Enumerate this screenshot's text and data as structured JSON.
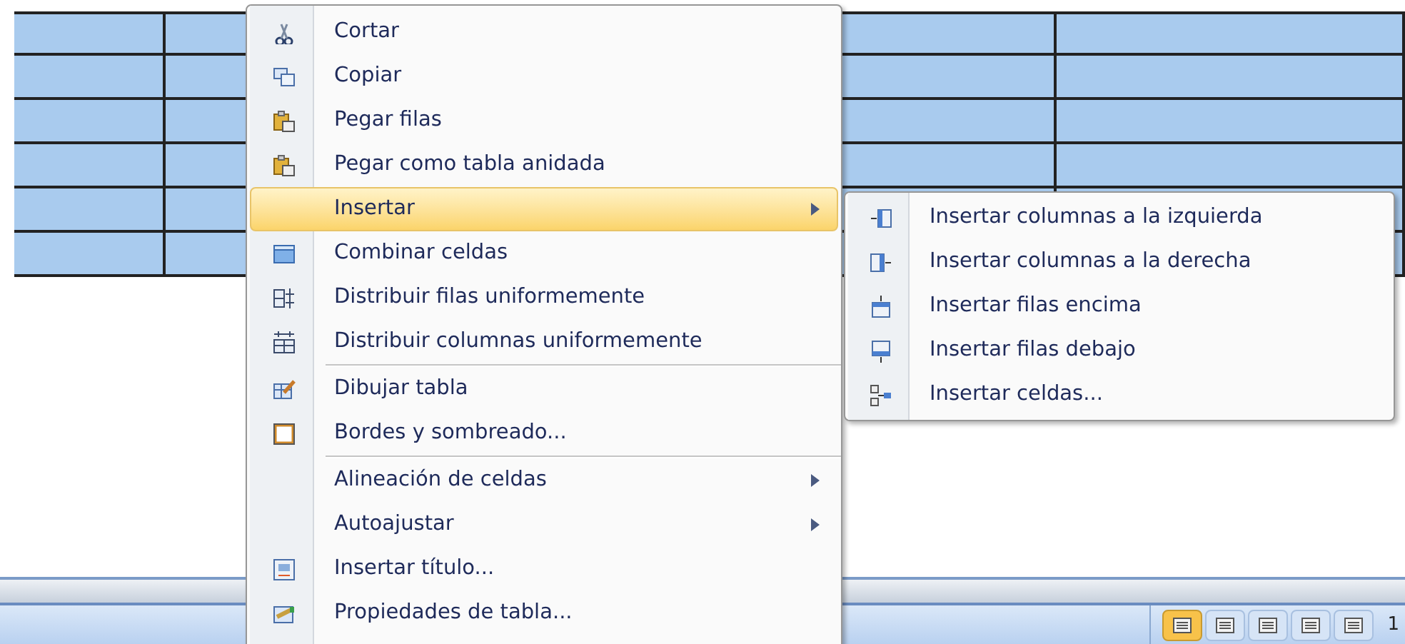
{
  "table": {
    "rows": [
      {
        "selected": true
      },
      {
        "selected": true
      },
      {
        "selected": true
      },
      {
        "selected": true
      },
      {
        "selected": true
      },
      {
        "selected": true
      }
    ]
  },
  "context_menu": {
    "items": [
      {
        "kind": "command",
        "label": "Cortar",
        "selected": false
      },
      {
        "kind": "command",
        "label": "Copiar",
        "selected": false
      },
      {
        "kind": "command",
        "label": "Pegar filas",
        "selected": false
      },
      {
        "kind": "command",
        "label": "Pegar como tabla anidada",
        "selected": false
      },
      {
        "kind": "submenu",
        "label": "Insertar",
        "selected": true
      },
      {
        "kind": "command",
        "label": "Combinar celdas",
        "selected": false
      },
      {
        "kind": "command",
        "label": "Distribuir filas uniformemente",
        "selected": false
      },
      {
        "kind": "command",
        "label": "Distribuir columnas uniformemente",
        "selected": false
      },
      {
        "kind": "separator"
      },
      {
        "kind": "command",
        "label": "Dibujar tabla",
        "selected": false
      },
      {
        "kind": "command",
        "label": "Bordes y sombreado...",
        "selected": false
      },
      {
        "kind": "separator"
      },
      {
        "kind": "submenu",
        "label": "Alineación de celdas",
        "selected": false
      },
      {
        "kind": "submenu",
        "label": "Autoajustar",
        "selected": false
      },
      {
        "kind": "command",
        "label": "Insertar título...",
        "selected": false
      },
      {
        "kind": "command",
        "label": "Propiedades de tabla...",
        "selected": false
      }
    ]
  },
  "submenu": {
    "items": [
      {
        "label": "Insertar columnas a la izquierda",
        "selected": false
      },
      {
        "label": "Insertar columnas a la derecha",
        "selected": false
      },
      {
        "label": "Insertar filas encima",
        "selected": false
      },
      {
        "label": "Insertar filas debajo",
        "selected": false
      },
      {
        "label": "Insertar celdas...",
        "selected": false
      }
    ]
  },
  "status_bar": {
    "view_buttons": [
      {
        "selected": true
      },
      {
        "selected": false
      },
      {
        "selected": false
      },
      {
        "selected": false
      },
      {
        "selected": false
      }
    ],
    "zoom": "1"
  }
}
